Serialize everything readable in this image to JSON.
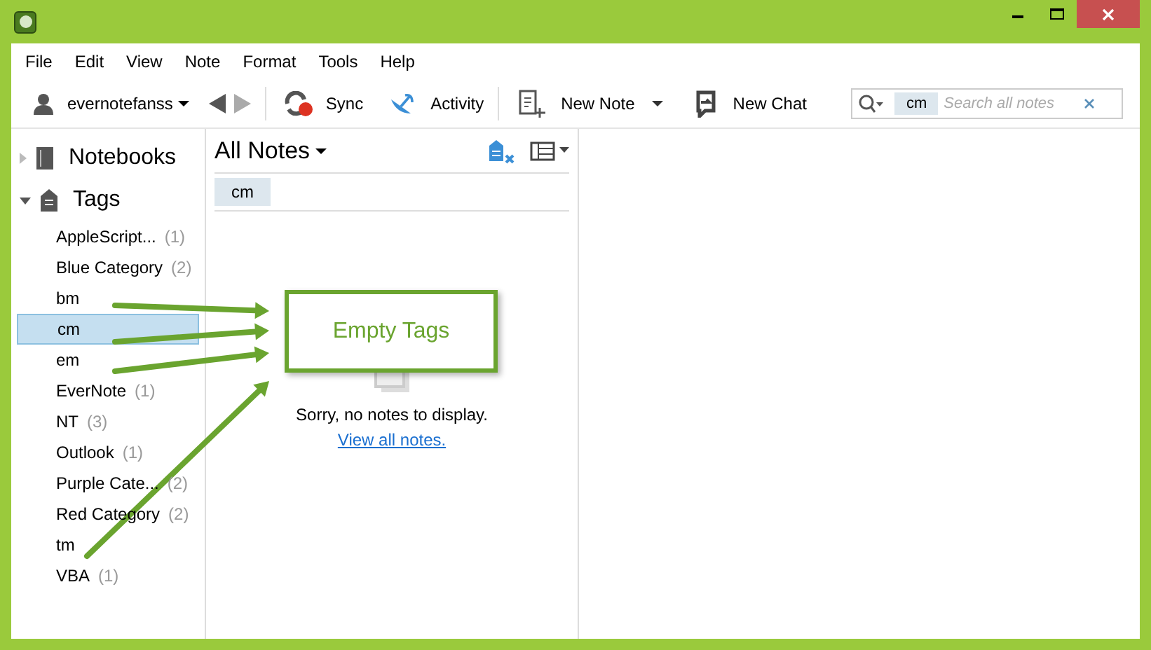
{
  "menu": [
    "File",
    "Edit",
    "View",
    "Note",
    "Format",
    "Tools",
    "Help"
  ],
  "toolbar": {
    "account": "evernotefanss",
    "sync": "Sync",
    "activity": "Activity",
    "new_note": "New Note",
    "new_chat": "New Chat"
  },
  "search": {
    "tag": "cm",
    "placeholder": "Search all notes"
  },
  "sidebar": {
    "notebooks": {
      "label": "Notebooks",
      "expanded": false
    },
    "tags": {
      "label": "Tags",
      "expanded": true
    },
    "items": [
      {
        "name": "AppleScript...",
        "count": "(1)",
        "selected": false
      },
      {
        "name": "Blue Category",
        "count": "(2)",
        "selected": false
      },
      {
        "name": "bm",
        "selected": false
      },
      {
        "name": "cm",
        "selected": true
      },
      {
        "name": "em",
        "selected": false
      },
      {
        "name": "EverNote",
        "count": "(1)",
        "selected": false
      },
      {
        "name": "NT",
        "count": "(3)",
        "selected": false
      },
      {
        "name": "Outlook",
        "count": "(1)",
        "selected": false
      },
      {
        "name": "Purple Cate...",
        "count": "(2)",
        "selected": false
      },
      {
        "name": "Red Category",
        "count": "(2)",
        "selected": false
      },
      {
        "name": "tm",
        "selected": false
      },
      {
        "name": "VBA",
        "count": "(1)",
        "selected": false
      }
    ]
  },
  "notes": {
    "title": "All Notes",
    "filter_tag": "cm",
    "empty_message": "Sorry, no notes to display.",
    "link": "View all notes."
  },
  "callout": {
    "text": "Empty Tags"
  }
}
